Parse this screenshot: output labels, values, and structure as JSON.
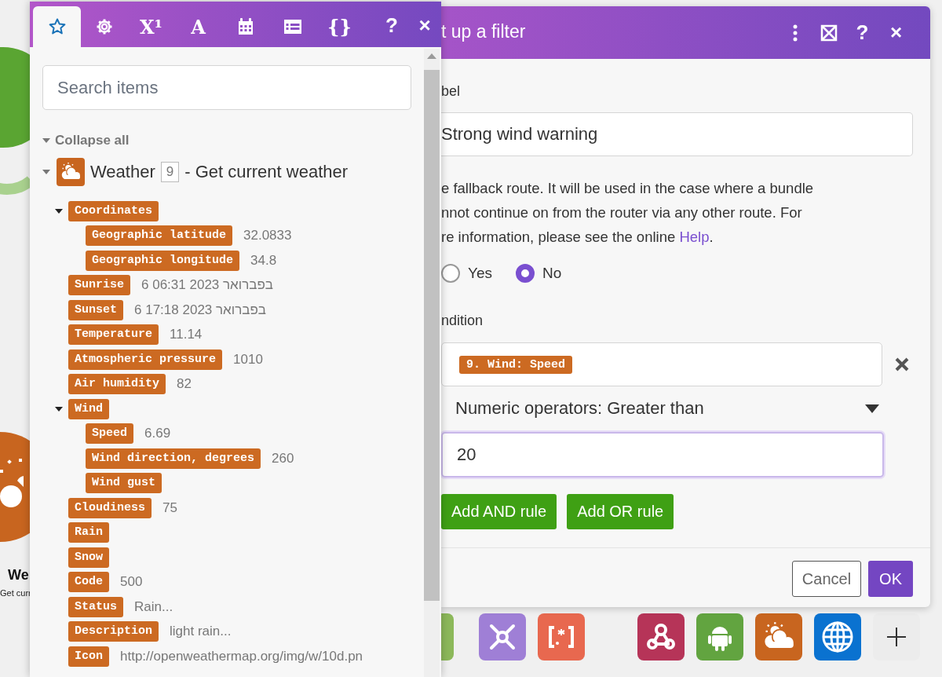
{
  "canvas": {
    "node": {
      "title": "We",
      "subtitle": "Get curr"
    }
  },
  "panel": {
    "tabs": [
      {
        "kind": "star",
        "selected": true
      },
      {
        "kind": "gear",
        "selected": false
      },
      {
        "kind": "text",
        "label": "X¹",
        "selected": false
      },
      {
        "kind": "text",
        "label": "A",
        "selected": false
      },
      {
        "kind": "calendar",
        "selected": false
      },
      {
        "kind": "table",
        "selected": false
      },
      {
        "kind": "text",
        "label": "{}",
        "selected": false
      }
    ],
    "help": "?",
    "close": "×",
    "search": {
      "placeholder": "Search items"
    },
    "collapse_all": "Collapse all",
    "module": {
      "name": "Weather",
      "number": "9",
      "description": "- Get current weather",
      "expanded": true,
      "children": [
        {
          "label": "Coordinates",
          "expanded": true,
          "children": [
            {
              "label": "Geographic latitude",
              "value": "32.0833"
            },
            {
              "label": "Geographic longitude",
              "value": "34.8"
            }
          ]
        },
        {
          "label": "Sunrise",
          "value": "6 בפברואר 2023 06:31"
        },
        {
          "label": "Sunset",
          "value": "6 בפברואר 2023 17:18"
        },
        {
          "label": "Temperature",
          "value": "11.14"
        },
        {
          "label": "Atmospheric pressure",
          "value": "1010"
        },
        {
          "label": "Air humidity",
          "value": "82"
        },
        {
          "label": "Wind",
          "expanded": true,
          "children": [
            {
              "label": "Speed",
              "value": "6.69"
            },
            {
              "label": "Wind direction, degrees",
              "value": "260"
            },
            {
              "label": "Wind gust"
            }
          ]
        },
        {
          "label": "Cloudiness",
          "value": "75"
        },
        {
          "label": "Rain"
        },
        {
          "label": "Snow"
        },
        {
          "label": "Code",
          "value": "500"
        },
        {
          "label": "Status",
          "value": "Rain..."
        },
        {
          "label": "Description",
          "value": "light rain..."
        },
        {
          "label": "Icon",
          "value": "http://openweathermap.org/img/w/10d.pn"
        }
      ]
    }
  },
  "dialog": {
    "title": "t up a filter",
    "help": "?",
    "close": "×",
    "label_caption": "bel",
    "label_value": "Strong wind warning",
    "fallback_lines": [
      "e fallback route. It will be used in the case where a bundle",
      "nnot continue on from the router via any other route. For",
      "re information, please see the online "
    ],
    "help_link": "Help",
    "fallback_end": ".",
    "fallback_options": [
      {
        "label": "Yes",
        "selected": false
      },
      {
        "label": "No",
        "selected": true
      }
    ],
    "condition": {
      "caption": "ndition",
      "operand": "9. Wind: Speed",
      "operator": "Numeric operators: Greater than",
      "value": "20"
    },
    "rule_buttons": [
      "Add AND rule",
      "Add OR rule"
    ],
    "footer_buttons": [
      {
        "label": "Cancel",
        "kind": "secondary"
      },
      {
        "label": "OK",
        "kind": "primary"
      }
    ]
  }
}
